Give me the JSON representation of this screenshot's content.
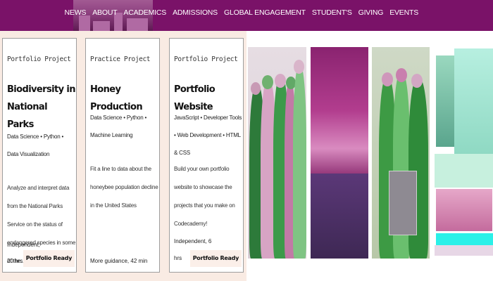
{
  "nav": {
    "items": [
      "NEWS",
      "ABOUT",
      "ACADEMICS",
      "ADMISSIONS",
      "GLOBAL ENGAGEMENT",
      "STUDENT'S",
      "GIVING",
      "EVENTS"
    ]
  },
  "cards": [
    {
      "type": "Portfolio Project",
      "title": "Biodiversity in National Parks",
      "tags": "Data Science • Python • Data Visualization",
      "description": "Analyze and interpret data from the National Parks Service on the status of endangered species in some of the…",
      "time": "Independent, 20 hrs",
      "badge": "Portfolio Ready"
    },
    {
      "type": "Practice Project",
      "title": "Honey Production",
      "tags": "Data Science • Python • Machine Learning",
      "description": "Fit a line to data about the honeybee population decline in the United States",
      "time": "More guidance, 42 min",
      "badge": ""
    },
    {
      "type": "Portfolio Project",
      "title": "Portfolio Website",
      "tags": "JavaScript • Developer Tools • Web Development • HTML & CSS",
      "description": "Build your own portfolio website to showcase the projects that you make on Codecademy!",
      "time": "Independent, 6 hrs",
      "badge": "Portfolio Ready"
    }
  ],
  "colors": {
    "nav_bg": "#7a1268",
    "cards_bg": "#f9ebe3",
    "badge_bg": "#fbefe9",
    "accent_strip": "#2bf0e8"
  }
}
